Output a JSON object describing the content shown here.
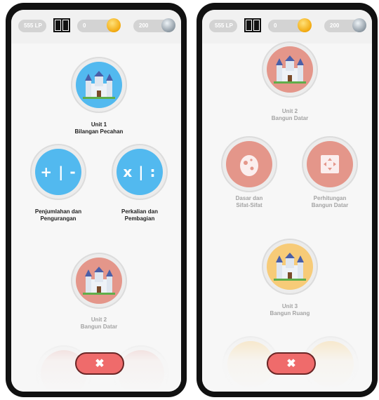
{
  "colors": {
    "blue": "#52b9ef",
    "salmon": "#e4968a",
    "yellow": "#f7cb78",
    "close_button": "#ef6b6b"
  },
  "left_screen": {
    "topbar": {
      "lp": "555 LP",
      "book_icon": "book-icon",
      "coins_gold": "0",
      "coins_silver": "200"
    },
    "nodes": [
      {
        "id": "unit1",
        "icon": "castle-icon",
        "color": "blue",
        "label_line1": "Unit 1",
        "label_line2": "Bilangan Pecahan",
        "status": "active"
      },
      {
        "id": "penjumlahan",
        "icon": "plus-minus-icon",
        "glyph": "+ | -",
        "color": "blue",
        "label_line1": "Penjumlahan dan",
        "label_line2": "Pengurangan",
        "status": "active"
      },
      {
        "id": "perkalian",
        "icon": "times-divide-icon",
        "glyph": "x | :",
        "color": "blue",
        "label_line1": "Perkalian dan",
        "label_line2": "Pembagian",
        "status": "active"
      },
      {
        "id": "unit2",
        "icon": "castle-icon",
        "color": "salmon",
        "label_line1": "Unit 2",
        "label_line2": "Bangun Datar",
        "status": "locked"
      }
    ],
    "close_button": "✖"
  },
  "right_screen": {
    "topbar": {
      "lp": "555 LP",
      "book_icon": "book-icon",
      "coins_gold": "0",
      "coins_silver": "200"
    },
    "nodes": [
      {
        "id": "unit2",
        "icon": "castle-icon",
        "color": "salmon",
        "label_line1": "Unit 2",
        "label_line2": "Bangun Datar",
        "status": "locked"
      },
      {
        "id": "dasar",
        "icon": "egg-icon",
        "color": "salmon",
        "label_line1": "Dasar dan",
        "label_line2": "Sifat-Sifat",
        "status": "locked"
      },
      {
        "id": "perhitungan",
        "icon": "square-arrows-icon",
        "color": "salmon",
        "label_line1": "Perhitungan",
        "label_line2": "Bangun Datar",
        "status": "locked"
      },
      {
        "id": "unit3",
        "icon": "castle-icon",
        "color": "yellow",
        "label_line1": "Unit 3",
        "label_line2": "Bangun Ruang",
        "status": "locked"
      }
    ],
    "close_button": "✖"
  }
}
